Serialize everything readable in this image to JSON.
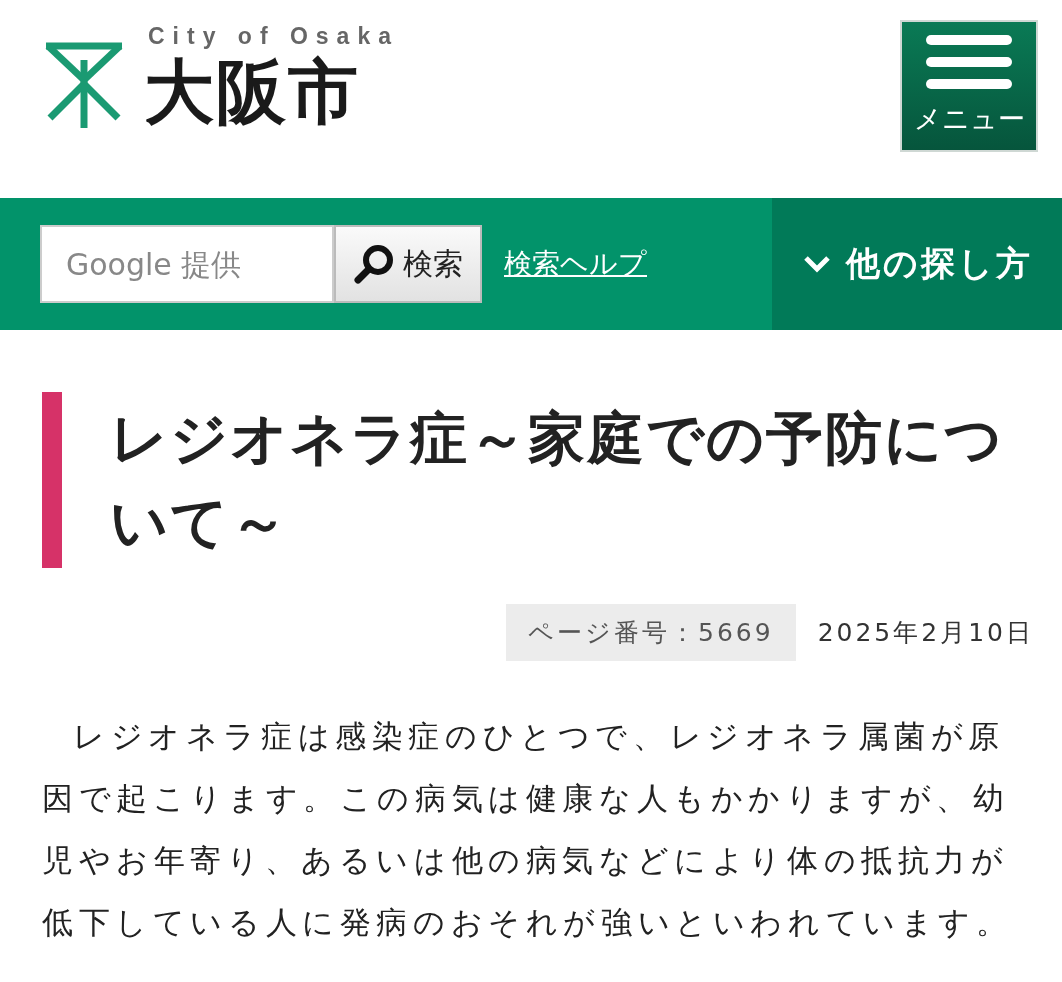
{
  "header": {
    "logo_subtitle": "City of Osaka",
    "logo_title": "大阪市",
    "menu_button": "メニュー"
  },
  "search_bar": {
    "search_field": {
      "placeholder": "Google 提供"
    },
    "search_button": "検索",
    "help_link": "検索ヘルプ",
    "other_ways_button": "他の探し方"
  },
  "article": {
    "title": "レジオネラ症～家庭での予防について～",
    "page_number": "ページ番号：5669",
    "date": "2025年2月10日",
    "paragraphs": [
      "レジオネラ症は感染症のひとつで、レジオネラ属菌が原因で起こります。この病気は健康な人もかかりますが、幼児やお年寄り、あるいは他の病気などにより体の抵抗力が低下している人に発病のおそれが強いといわれています。"
    ]
  }
}
